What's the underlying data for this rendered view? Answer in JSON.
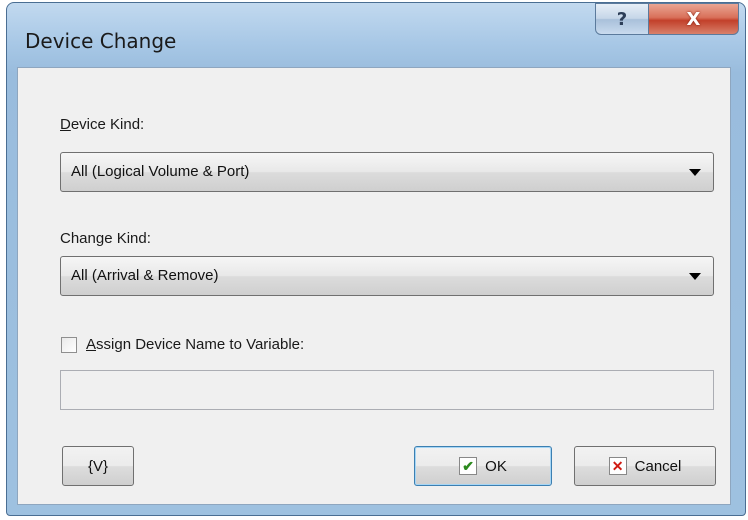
{
  "window": {
    "title": "Device Change",
    "help_glyph": "?",
    "close_glyph": "X"
  },
  "device_kind": {
    "label_underline": "D",
    "label_rest": "evice Kind:",
    "selected": "All (Logical Volume & Port)"
  },
  "change_kind": {
    "label": "Change Kind:",
    "selected": "All (Arrival & Remove)"
  },
  "assign": {
    "checked": false,
    "label_underline": "A",
    "label_rest": "ssign Device Name to Variable:",
    "value": ""
  },
  "buttons": {
    "variables_label": "{V}",
    "ok_label": "OK",
    "cancel_label": "Cancel",
    "ok_icon": "check-icon",
    "cancel_icon": "x-icon"
  },
  "colors": {
    "frame": "#a8c8e6",
    "client": "#f0f0f0",
    "close": "#c2402a",
    "check": "#2c8a1e",
    "cross": "#d01a12"
  }
}
